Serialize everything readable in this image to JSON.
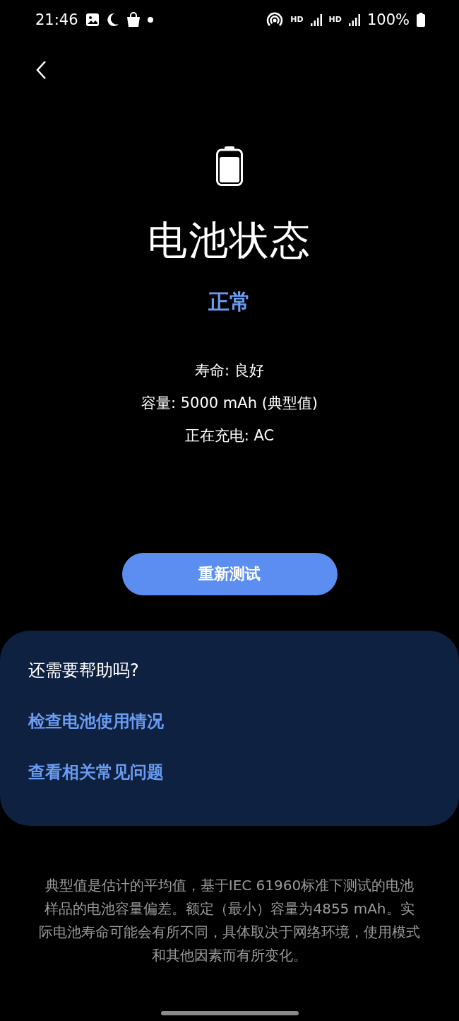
{
  "status_bar": {
    "time": "21:46",
    "network_labels": [
      "HD",
      "HD"
    ],
    "battery_percent": "100%"
  },
  "title": "电池状态",
  "status": "正常",
  "details": [
    "寿命: 良好",
    "容量: 5000 mAh (典型值)",
    "正在充电: AC"
  ],
  "retest_button": "重新测试",
  "help": {
    "heading": "还需要帮助吗?",
    "links": [
      "检查电池使用情况",
      "查看相关常见问题"
    ]
  },
  "footnote": "典型值是估计的平均值，基于IEC 61960标准下测试的电池样品的电池容量偏差。额定（最小）容量为4855 mAh。实际电池寿命可能会有所不同，具体取决于网络环境，使用模式和其他因素而有所变化。"
}
